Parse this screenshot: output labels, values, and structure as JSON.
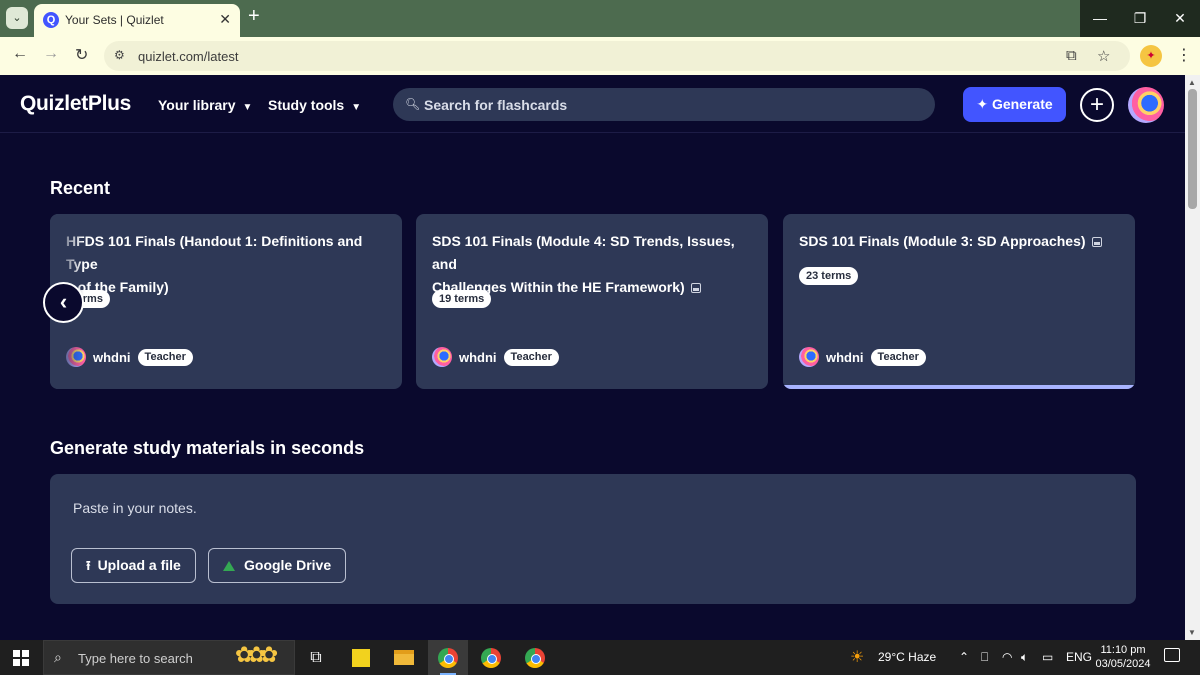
{
  "browser": {
    "tab_title": "Your Sets | Quizlet",
    "favicon_letter": "Q",
    "new_tab_symbol": "+",
    "close_symbol": "✕",
    "url": "quizlet.com/latest",
    "window_controls": [
      "—",
      "❐",
      "✕"
    ]
  },
  "header": {
    "logo": "QuizletPlus",
    "nav": [
      "Your library",
      "Study tools"
    ],
    "search_placeholder": "Search for flashcards",
    "generate_label": "Generate",
    "generate_icon": "✦",
    "plus_symbol": "+"
  },
  "recent": {
    "title": "Recent",
    "cards": [
      {
        "title_part1": "HFDS 101 Finals (Handout 1: Definitions and Type",
        "title_part2": "s of the Family)",
        "terms": "terms",
        "has_image_icon": false,
        "author": "whdni",
        "role": "Teacher"
      },
      {
        "title_part1": "SDS 101 Finals (Module 4: SD Trends, Issues, and",
        "title_part2": "Challenges Within the HE Framework)",
        "terms": "19 terms",
        "has_image_icon": true,
        "author": "whdni",
        "role": "Teacher"
      },
      {
        "title_part1": "SDS 101 Finals (Module 3: SD Approaches)",
        "title_part2": "",
        "terms": "23 terms",
        "has_image_icon": true,
        "author": "whdni",
        "role": "Teacher"
      }
    ]
  },
  "generate_section": {
    "title": "Generate study materials in seconds",
    "placeholder": "Paste in your notes.",
    "upload_label": "Upload a file",
    "drive_label": "Google Drive"
  },
  "taskbar": {
    "search_placeholder": "Type here to search",
    "weather": "29°C  Haze",
    "language": "ENG",
    "time": "11:10 pm",
    "date": "03/05/2024"
  },
  "colors": {
    "page_bg": "#0a092d",
    "card_bg": "#2e3856",
    "primary": "#4255ff",
    "card_active_bar": "#a8b3ff"
  },
  "icons": {
    "search": "search-icon",
    "image": "image-icon",
    "upload": "upload-icon",
    "drive": "google-drive-icon",
    "prev": "chevron-left-icon",
    "avatar": "avatar"
  }
}
